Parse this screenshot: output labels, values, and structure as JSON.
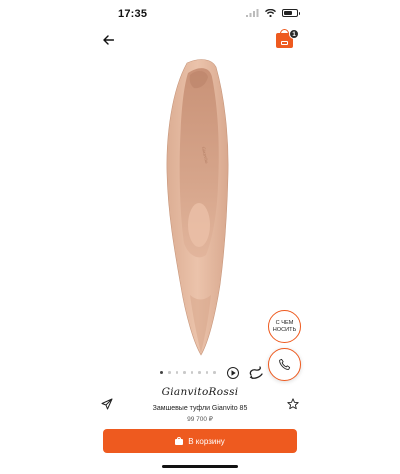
{
  "status_bar": {
    "time": "17:35",
    "icons": [
      "signal-icon",
      "wifi-icon",
      "battery-icon"
    ]
  },
  "header": {
    "back_icon": "arrow-left-icon",
    "cart": {
      "icon": "shopping-bag-icon",
      "badge_count": "1"
    }
  },
  "gallery": {
    "image_alt": "nude suede pointed pump",
    "dots_total": 8,
    "active_index": 0,
    "play_icon": "play-icon",
    "rotate_icon": "360-rotate-icon"
  },
  "side_actions": {
    "style_advice_label": "С ЧЕМ НОСИТЬ",
    "call_icon": "phone-icon"
  },
  "product": {
    "brand": "GianvitoRossi",
    "name": "Замшевые туфли Gianvito 85",
    "price": "99 700 ₽",
    "share_icon": "share-icon",
    "favorite_icon": "star-icon"
  },
  "actions": {
    "add_to_cart_label": "В корзину",
    "add_to_cart_icon": "shopping-bag-icon"
  },
  "colors": {
    "accent": "#ee5a1f",
    "shoe": "#e4b8a0"
  }
}
